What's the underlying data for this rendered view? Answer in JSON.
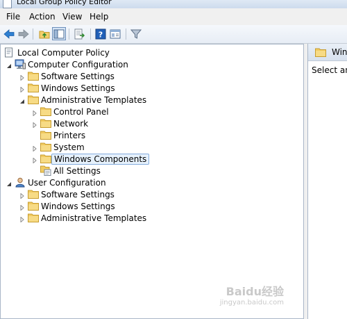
{
  "window": {
    "title": "Local Group Policy Editor"
  },
  "menu": [
    "File",
    "Action",
    "View",
    "Help"
  ],
  "toolbar": [
    {
      "name": "back-arrow-icon"
    },
    {
      "name": "forward-arrow-icon"
    },
    {
      "name": "up-folder-icon"
    },
    {
      "name": "show-hide-tree-icon"
    },
    {
      "name": "export-list-icon"
    },
    {
      "name": "help-icon"
    },
    {
      "name": "properties-icon"
    },
    {
      "name": "filter-icon"
    }
  ],
  "tree": {
    "root": "Local Computer Policy",
    "computer_config": "Computer Configuration",
    "cc_software": "Software Settings",
    "cc_windows": "Windows Settings",
    "cc_admin": "Administrative Templates",
    "at_control_panel": "Control Panel",
    "at_network": "Network",
    "at_printers": "Printers",
    "at_system": "System",
    "at_windows_components": "Windows Components",
    "at_all_settings": "All Settings",
    "user_config": "User Configuration",
    "uc_software": "Software Settings",
    "uc_windows": "Windows Settings",
    "uc_admin": "Administrative Templates",
    "selected": "Windows Components"
  },
  "right_pane": {
    "header": "Windows Components",
    "hint": "Select an item to view its description."
  },
  "watermark": {
    "line1": "Baidu经验",
    "line2": "jingyan.baidu.com"
  }
}
